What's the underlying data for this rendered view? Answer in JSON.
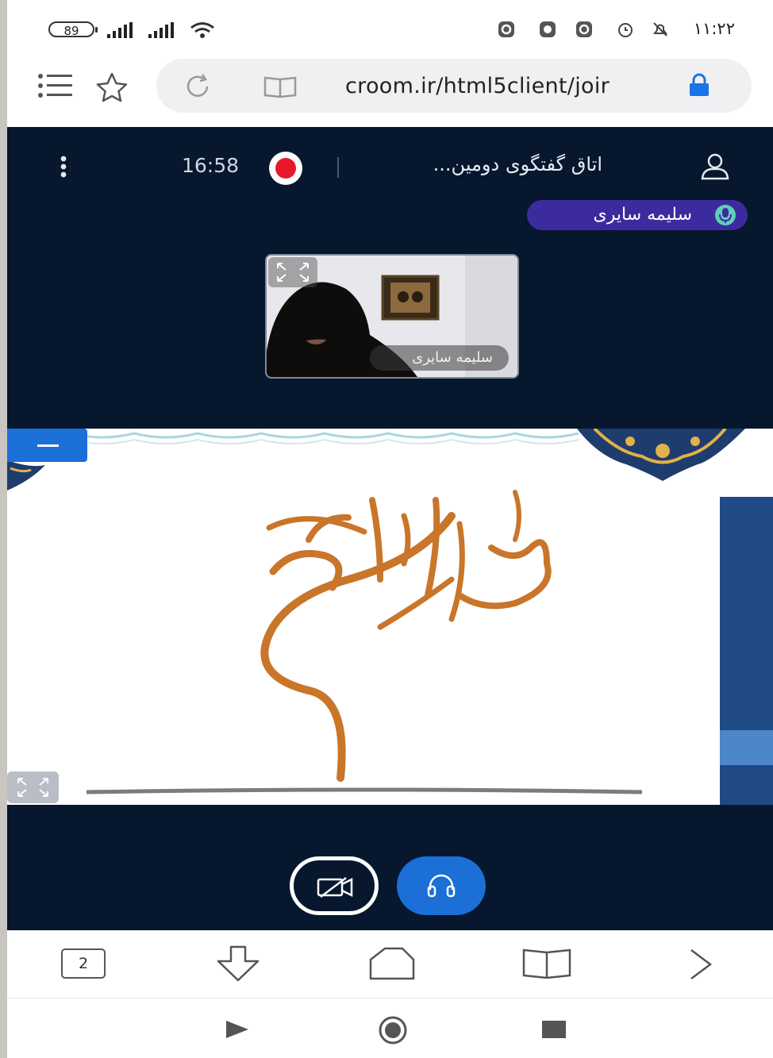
{
  "status_bar": {
    "battery": "89",
    "time": "۱۱:۲۲"
  },
  "browser": {
    "url": "croom.ir/html5client/joir",
    "tab_count": "2"
  },
  "meeting": {
    "room_title": "اتاق گفتگوی دومین...",
    "timer": "16:58",
    "talking_user": "سلیمه سایری",
    "webcam_user": "سلیمه سایری"
  },
  "colors": {
    "meeting_bg": "#06172e",
    "talking_badge": "#3c2b9e",
    "accent_blue": "#1b6fd6",
    "record_red": "#e8172b",
    "calligraphy": "#c9752a"
  },
  "icons": {
    "menu": "hamburger-icon",
    "bookmark": "star-icon",
    "reload": "reload-icon",
    "reader": "book-icon",
    "secure": "lock-icon",
    "user_list": "user-icon",
    "options": "kebab-icon",
    "recording": "record-icon",
    "mic": "mic-icon",
    "fullscreen": "fullscreen-icon",
    "video_off": "video-off-icon",
    "audio": "headphones-icon"
  }
}
